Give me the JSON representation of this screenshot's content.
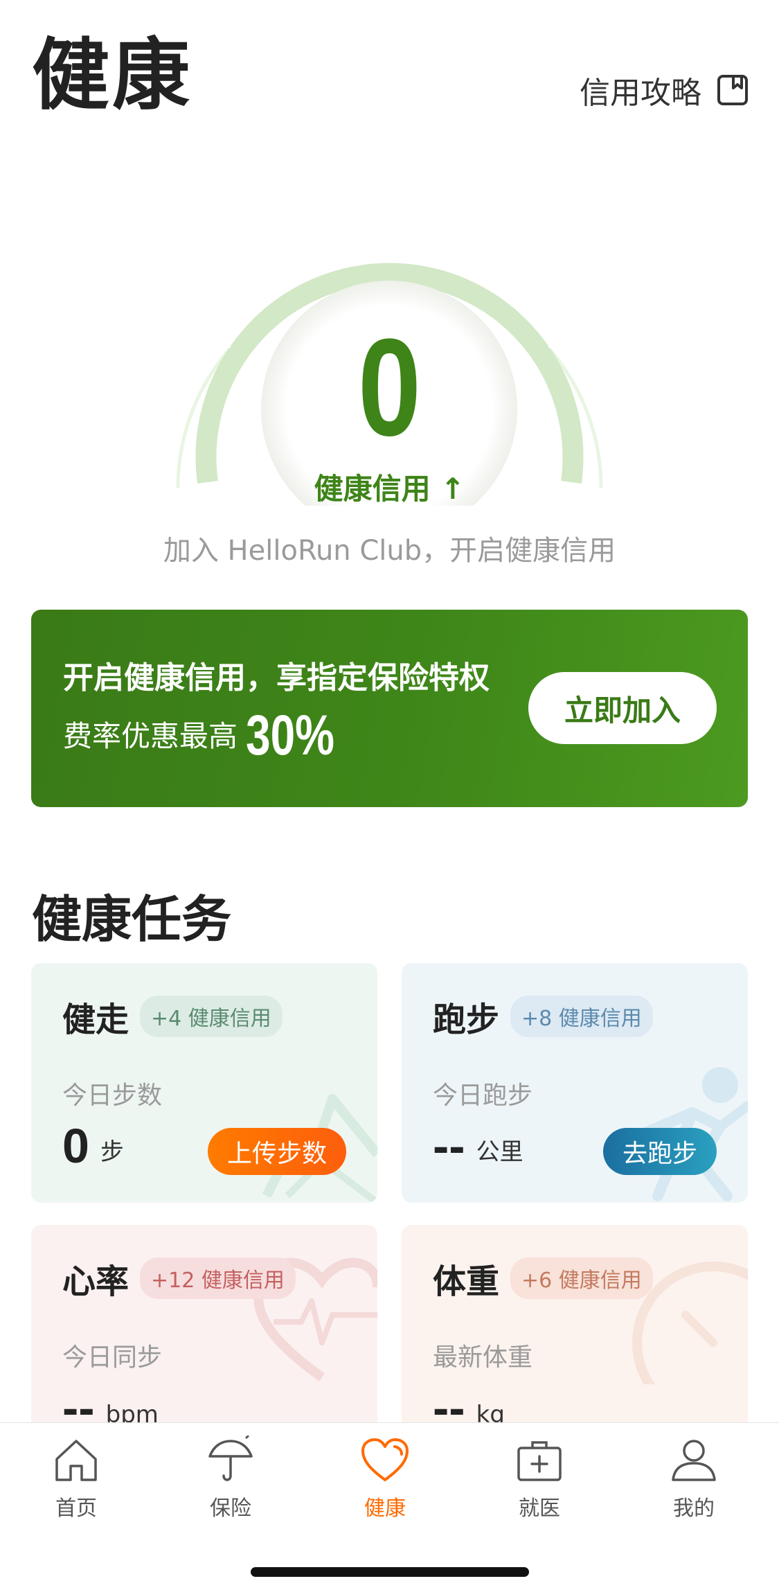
{
  "header": {
    "title": "健康",
    "guide_label": "信用攻略",
    "guide_icon": "bookmark-icon"
  },
  "credit": {
    "value": "0",
    "label": "健康信用 ↑",
    "subtitle": "加入 HelloRun Club，开启健康信用"
  },
  "promo": {
    "line1": "开启健康信用，享指定保险特权",
    "line2_prefix": "费率优惠最高",
    "discount": "30%",
    "button": "立即加入"
  },
  "tasks": {
    "title": "健康任务",
    "items": [
      {
        "name": "健走",
        "badge": "+4 健康信用",
        "sub": "今日步数",
        "value": "0",
        "unit": "步",
        "button": "上传步数",
        "icon": "mountain-icon"
      },
      {
        "name": "跑步",
        "badge": "+8 健康信用",
        "sub": "今日跑步",
        "value": "--",
        "unit": "公里",
        "button": "去跑步",
        "icon": "runner-icon"
      },
      {
        "name": "心率",
        "badge": "+12 健康信用",
        "sub": "今日同步",
        "value": "--",
        "unit": "bpm",
        "icon": "heart-pulse-icon"
      },
      {
        "name": "体重",
        "badge": "+6 健康信用",
        "sub": "最新体重",
        "value": "--",
        "unit": "kg",
        "icon": "scale-icon"
      }
    ]
  },
  "tabbar": {
    "active": "健康",
    "accent_color": "#ff6a00",
    "items": [
      {
        "label": "首页",
        "icon": "home-icon"
      },
      {
        "label": "保险",
        "icon": "umbrella-icon"
      },
      {
        "label": "健康",
        "icon": "heart-icon"
      },
      {
        "label": "就医",
        "icon": "medical-kit-icon"
      },
      {
        "label": "我的",
        "icon": "person-icon"
      }
    ]
  }
}
